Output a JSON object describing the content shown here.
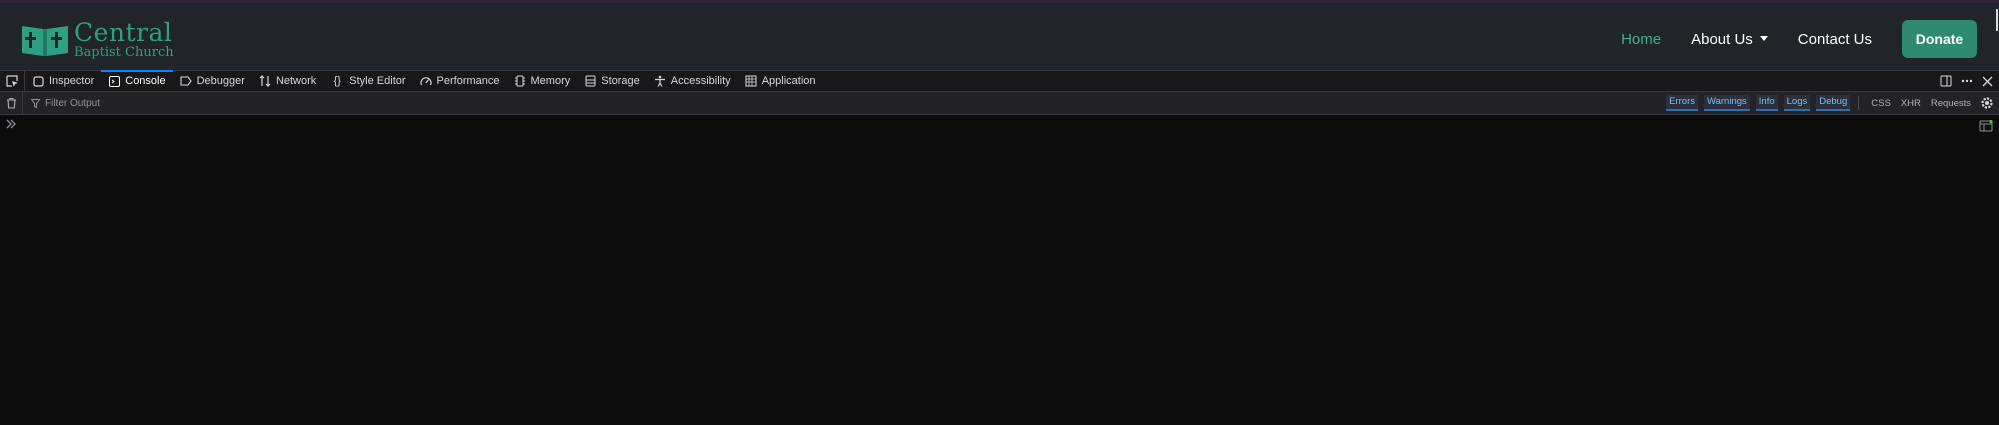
{
  "site": {
    "logo": {
      "line1": "Central",
      "line2": "Baptist Church"
    },
    "nav": [
      {
        "label": "Home",
        "active": true
      },
      {
        "label": "About Us",
        "dropdown": true
      },
      {
        "label": "Contact Us"
      }
    ],
    "donate_label": "Donate",
    "colors": {
      "header_bg": "#212529",
      "accent": "#2e8b72",
      "active_link": "#3fae94"
    }
  },
  "devtools": {
    "tabs": [
      {
        "label": "Inspector",
        "icon": "inspector-icon"
      },
      {
        "label": "Console",
        "icon": "console-icon",
        "selected": true
      },
      {
        "label": "Debugger",
        "icon": "debugger-icon"
      },
      {
        "label": "Network",
        "icon": "network-icon"
      },
      {
        "label": "Style Editor",
        "icon": "style-editor-icon"
      },
      {
        "label": "Performance",
        "icon": "performance-icon"
      },
      {
        "label": "Memory",
        "icon": "memory-icon"
      },
      {
        "label": "Storage",
        "icon": "storage-icon"
      },
      {
        "label": "Accessibility",
        "icon": "accessibility-icon"
      },
      {
        "label": "Application",
        "icon": "application-icon"
      }
    ],
    "filter_placeholder": "Filter Output",
    "levels": [
      "Errors",
      "Warnings",
      "Info",
      "Logs",
      "Debug"
    ],
    "extra_filters": [
      "CSS",
      "XHR",
      "Requests"
    ]
  }
}
